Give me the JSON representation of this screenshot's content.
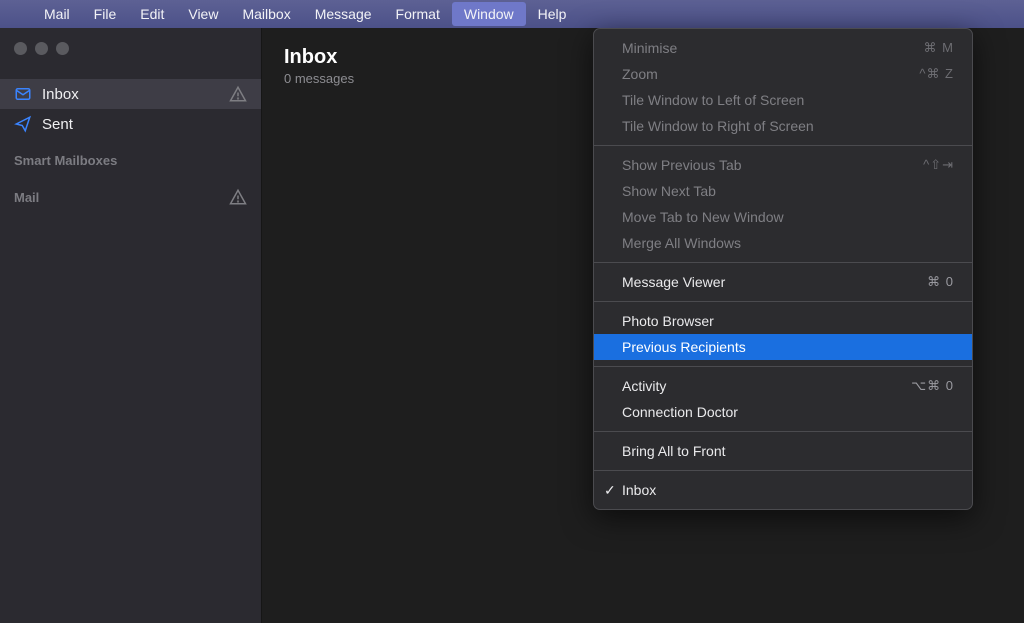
{
  "menubar": {
    "items": [
      "Mail",
      "File",
      "Edit",
      "View",
      "Mailbox",
      "Message",
      "Format",
      "Window",
      "Help"
    ],
    "selected": "Window"
  },
  "sidebar": {
    "inbox": "Inbox",
    "sent": "Sent",
    "smart_heading": "Smart Mailboxes",
    "mail_heading": "Mail"
  },
  "list_header": {
    "title": "Inbox",
    "subtitle": "0 messages"
  },
  "dropdown": {
    "minimise": "Minimise",
    "minimise_sc": "⌘ M",
    "zoom": "Zoom",
    "zoom_sc": "^⌘ Z",
    "tile_left": "Tile Window to Left of Screen",
    "tile_right": "Tile Window to Right of Screen",
    "prev_tab": "Show Previous Tab",
    "prev_tab_sc": "^⇧⇥",
    "next_tab": "Show Next Tab",
    "move_tab": "Move Tab to New Window",
    "merge": "Merge All Windows",
    "msg_viewer": "Message Viewer",
    "msg_viewer_sc": "⌘ 0",
    "photo": "Photo Browser",
    "prev_recip": "Previous Recipients",
    "activity": "Activity",
    "activity_sc": "⌥⌘ 0",
    "conn": "Connection Doctor",
    "bring": "Bring All to Front",
    "inbox_win": "Inbox"
  }
}
